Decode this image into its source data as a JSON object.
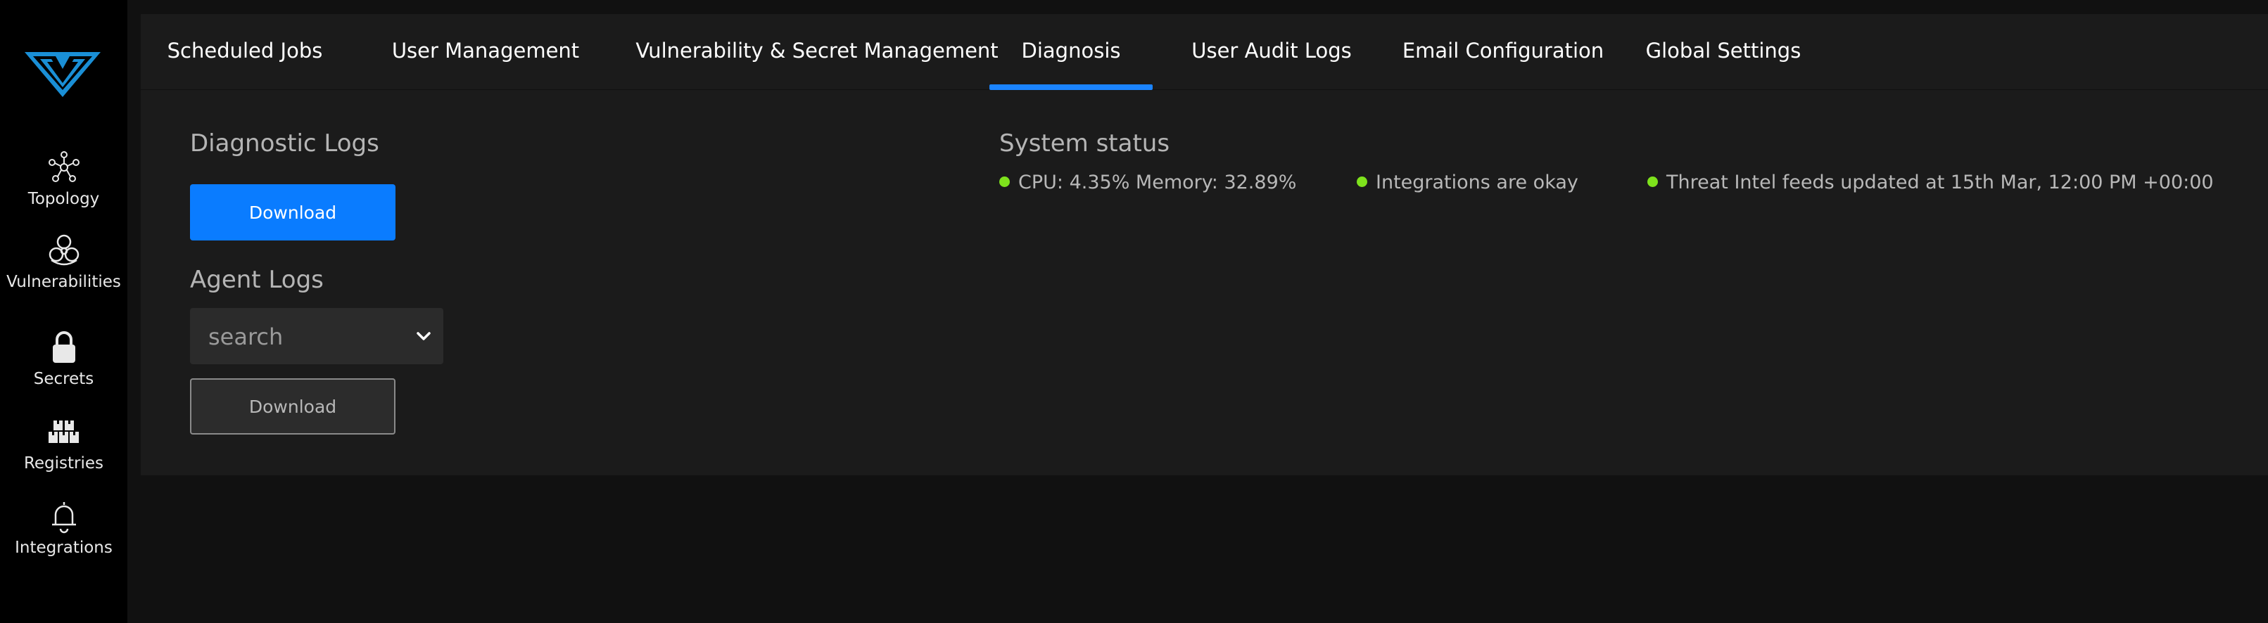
{
  "sidebar": {
    "items": [
      {
        "label": "Topology",
        "icon": "topology-icon"
      },
      {
        "label": "Vulnerabilities",
        "icon": "biohazard-icon"
      },
      {
        "label": "Secrets",
        "icon": "lock-icon"
      },
      {
        "label": "Registries",
        "icon": "registries-icon"
      },
      {
        "label": "Integrations",
        "icon": "bell-icon"
      }
    ]
  },
  "tabs": [
    {
      "label": "Scheduled Jobs"
    },
    {
      "label": "User Management"
    },
    {
      "label": "Vulnerability & Secret Management"
    },
    {
      "label": "Diagnosis",
      "active": true
    },
    {
      "label": "User Audit Logs"
    },
    {
      "label": "Email Configuration"
    },
    {
      "label": "Global Settings"
    }
  ],
  "diagnostic_logs": {
    "title": "Diagnostic Logs",
    "download_label": "Download"
  },
  "agent_logs": {
    "title": "Agent Logs",
    "select_placeholder": "search",
    "download_label": "Download"
  },
  "system_status": {
    "title": "System status",
    "items": [
      {
        "text": "CPU: 4.35% Memory: 32.89%"
      },
      {
        "text": "Integrations are okay"
      },
      {
        "text": "Threat Intel feeds updated at 15th Mar, 12:00 PM +00:00"
      }
    ]
  },
  "colors": {
    "accent": "#0a7cff",
    "status_ok": "#7ee21c",
    "background": "#111111",
    "panel": "#1b1b1b",
    "sidebar": "#000000"
  }
}
